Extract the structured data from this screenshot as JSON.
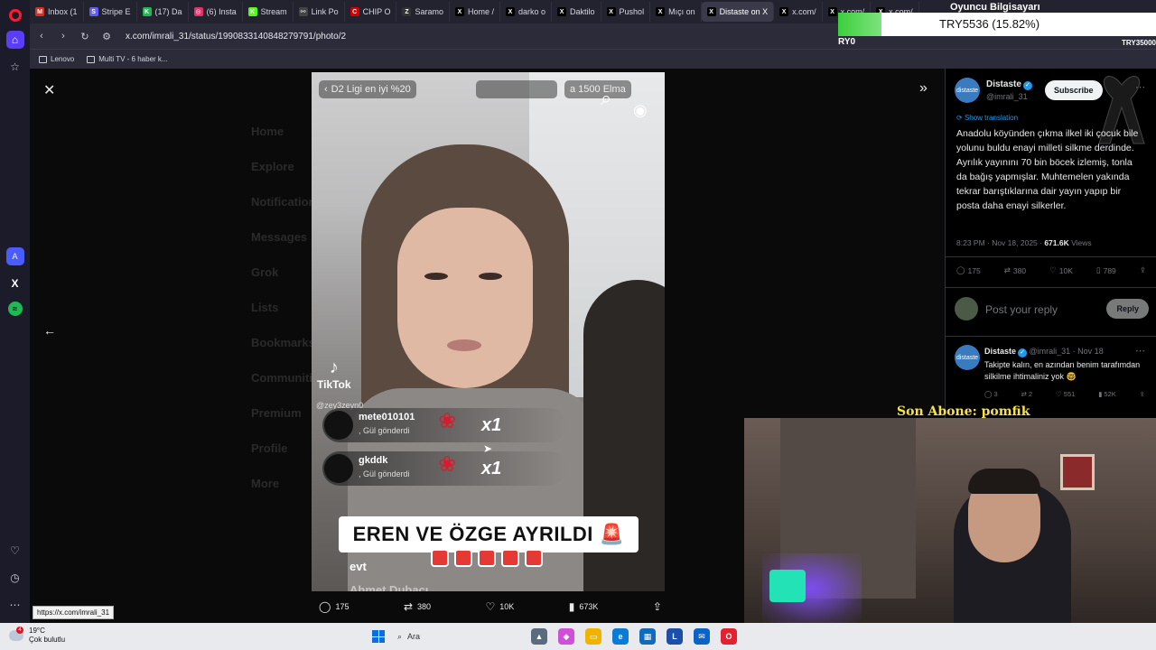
{
  "browser": {
    "tabs": [
      {
        "label": "Inbox (1",
        "color": "#d93025",
        "icon": "M"
      },
      {
        "label": "Stripe E",
        "color": "#635bff",
        "icon": "S"
      },
      {
        "label": "(17) Da",
        "color": "#1db954",
        "icon": "K"
      },
      {
        "label": "(6) Insta",
        "color": "#e1306c",
        "icon": "◎"
      },
      {
        "label": "Stream",
        "color": "#53fc18",
        "icon": "K"
      },
      {
        "label": "Link Po",
        "color": "#444444",
        "icon": "⚯"
      },
      {
        "label": "CHIP O",
        "color": "#d40000",
        "icon": "C"
      },
      {
        "label": "Saramo",
        "color": "#333333",
        "icon": "Z"
      },
      {
        "label": "Home /",
        "color": "#000000",
        "icon": "X"
      },
      {
        "label": "darko o",
        "color": "#000000",
        "icon": "X"
      },
      {
        "label": "Daktilo",
        "color": "#000000",
        "icon": "X"
      },
      {
        "label": "Pushol",
        "color": "#000000",
        "icon": "X"
      },
      {
        "label": "Mıçı on",
        "color": "#000000",
        "icon": "X"
      },
      {
        "label": "Distaste on X",
        "color": "#000000",
        "icon": "X",
        "active": true
      },
      {
        "label": "x.com/",
        "color": "#000000",
        "icon": "X"
      },
      {
        "label": "x.com/",
        "color": "#000000",
        "icon": "X"
      },
      {
        "label": "x.com/",
        "color": "#000000",
        "icon": "X"
      }
    ],
    "url": "x.com/imrali_31/status/1990833140848279791/photo/2",
    "bookmarks": [
      "Lenovo",
      "Multi TV - 6 haber k..."
    ],
    "status_url": "https://x.com/imrali_31"
  },
  "background_nav": [
    "Home",
    "Explore",
    "Notifications",
    "Messages",
    "Grok",
    "Lists",
    "Bookmarks",
    "Communities",
    "Premium",
    "Profile",
    "More"
  ],
  "video": {
    "top_left": "D2 Ligi en iyi %20",
    "top_right": "a 1500 Elma",
    "tiktok_label": "TikTok",
    "tiktok_user": "@zey3zeyn0",
    "gifts": [
      {
        "name": "mete010101",
        "sub": ", Gül gönderdi",
        "count": "x1"
      },
      {
        "name": "gkddk",
        "sub": ", Gül gönderdi",
        "count": "x1"
      }
    ],
    "banner": "EREN VE ÖZGE AYRILDI 🚨",
    "comment1": "evt",
    "comment2": "Ahmet Dubacı"
  },
  "video_actions": {
    "replies": "175",
    "reposts": "380",
    "likes": "10K",
    "views": "673K"
  },
  "tweet": {
    "avatar_text": "distaste",
    "name": "Distaste",
    "handle": "@imrali_31",
    "subscribe": "Subscribe",
    "show_translation": "Show translation",
    "text": "Anadolu köyünden çıkma ilkel iki çocuk bile yolunu buldu enayi milleti silkme derdinde. Ayrılık yayınını 70 bin böcek izlemiş, tonla da bağış yapmışlar. Muhtemelen yakında tekrar barıştıklarına dair yayın yapıp bir posta daha enayi silkerler.",
    "time": "8:23 PM · Nov 18, 2025 · ",
    "views_count": "671.6K",
    "views_label": " Views",
    "actions": {
      "replies": "175",
      "reposts": "380",
      "likes": "10K",
      "bookmarks": "789"
    },
    "reply_placeholder": "Post your reply",
    "reply_button": "Reply"
  },
  "reply": {
    "name": "Distaste",
    "meta": "@imrali_31 · Nov 18",
    "text": "Takipte kalın, en azından benim tarafımdan silkilme ihtimaliniz yok 🤓",
    "actions": {
      "replies": "3",
      "reposts": "2",
      "likes": "551",
      "views": "52K"
    }
  },
  "overlay": {
    "streamer_title": "Oyuncu Bilgisayarı",
    "stock_value": "TRY5536 (15.82%)",
    "stock_left": "RY0",
    "stock_right": "TRY35000",
    "son_abone": "Son Abone: pomfik"
  },
  "taskbar": {
    "temp": "19°C",
    "weather": "Çok bulutlu",
    "badge": "4",
    "search": "Ara",
    "apps": [
      {
        "icon": "▲",
        "color": "#5a6b7d"
      },
      {
        "icon": "◆",
        "color": "#d04fd9"
      },
      {
        "icon": "▭",
        "color": "#f0b400"
      },
      {
        "icon": "e",
        "color": "#0c7bd6"
      },
      {
        "icon": "▦",
        "color": "#0f6cbd"
      },
      {
        "icon": "L",
        "color": "#1b4fa8"
      },
      {
        "icon": "✉",
        "color": "#0a64c8"
      },
      {
        "icon": "O",
        "color": "#e3222f"
      }
    ]
  }
}
